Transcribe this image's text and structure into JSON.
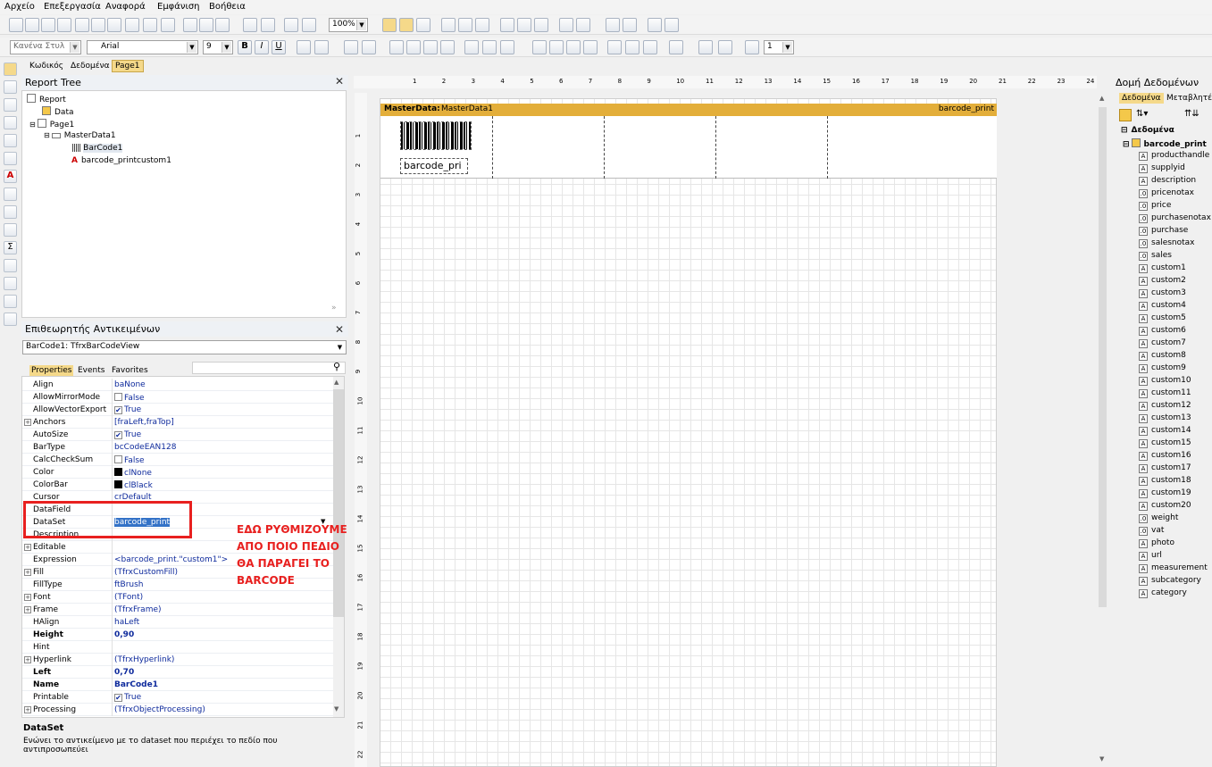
{
  "menu": [
    "Αρχείο",
    "Επεξεργασία",
    "Αναφορά",
    "Εμφάνιση",
    "Βοήθεια"
  ],
  "toolbar": {
    "zoom": "100%"
  },
  "format_toolbar": {
    "style": "Κανένα Στυλ",
    "font": "Arial",
    "size": "9",
    "bold": "B",
    "italic": "I",
    "underline": "U",
    "frame_width": "1"
  },
  "tabs": [
    "Κωδικός",
    "Δεδομένα",
    "Page1"
  ],
  "report_tree": {
    "title": "Report Tree",
    "nodes": [
      "Report",
      "Data",
      "Page1",
      "MasterData1",
      "BarCode1",
      "barcode_printcustom1"
    ]
  },
  "inspector": {
    "title": "Επιθεωρητής Αντικειμένων",
    "object": "BarCode1: TfrxBarCodeView",
    "tabs": [
      "Properties",
      "Events",
      "Favorites"
    ],
    "rows": [
      {
        "name": "Align",
        "value": "baNone"
      },
      {
        "name": "AllowMirrorMode",
        "value": "False"
      },
      {
        "name": "AllowVectorExport",
        "value": "True"
      },
      {
        "name": "Anchors",
        "value": "[fraLeft,fraTop]"
      },
      {
        "name": "AutoSize",
        "value": "True"
      },
      {
        "name": "BarType",
        "value": "bcCodeEAN128"
      },
      {
        "name": "CalcCheckSum",
        "value": "False"
      },
      {
        "name": "Color",
        "value": "clNone"
      },
      {
        "name": "ColorBar",
        "value": "clBlack"
      },
      {
        "name": "Cursor",
        "value": "crDefault"
      },
      {
        "name": "DataField",
        "value": ""
      },
      {
        "name": "DataSet",
        "value": "barcode_print"
      },
      {
        "name": "Description",
        "value": ""
      },
      {
        "name": "Editable",
        "value": ""
      },
      {
        "name": "Expression",
        "value": "<barcode_print.\"custom1\">"
      },
      {
        "name": "Fill",
        "value": "(TfrxCustomFill)"
      },
      {
        "name": "FillType",
        "value": "ftBrush"
      },
      {
        "name": "Font",
        "value": "(TFont)"
      },
      {
        "name": "Frame",
        "value": "(TfrxFrame)"
      },
      {
        "name": "HAlign",
        "value": "haLeft"
      },
      {
        "name": "Height",
        "value": "0,90"
      },
      {
        "name": "Hint",
        "value": ""
      },
      {
        "name": "Hyperlink",
        "value": "(TfrxHyperlink)"
      },
      {
        "name": "Left",
        "value": "0,70"
      },
      {
        "name": "Name",
        "value": "BarCode1"
      },
      {
        "name": "Printable",
        "value": "True"
      },
      {
        "name": "Processing",
        "value": "(TfrxObjectProcessing)"
      }
    ],
    "help_title": "DataSet",
    "help_text": "Ενώνει το αντικείμενο με το dataset που περιέχει το πεδίο που αντιπροσωπεύει"
  },
  "annotation": [
    "ΕΔΩ ΡΥΘΜΙΖΟΥΜΕ",
    "ΑΠΟ ΠΟΙΟ ΠΕΔΙΟ",
    "ΘΑ ΠΑΡΑΓΕΙ ΤΟ",
    "BARCODE"
  ],
  "designer": {
    "band_title_bold": "MasterData:",
    "band_title": "MasterData1",
    "band_dataset": "barcode_print",
    "barcode_text": "barcode_pri",
    "ruler_top": [
      "1",
      "2",
      "3",
      "4",
      "5",
      "6",
      "7",
      "8",
      "9",
      "10",
      "11",
      "12",
      "13",
      "14",
      "15",
      "16",
      "17",
      "18",
      "19",
      "20",
      "21",
      "22",
      "23",
      "24"
    ],
    "ruler_left": [
      "1",
      "2",
      "3",
      "4",
      "5",
      "6",
      "7",
      "8",
      "9",
      "10",
      "11",
      "12",
      "13",
      "14",
      "15",
      "16",
      "17",
      "18",
      "19",
      "20",
      "21",
      "22"
    ]
  },
  "data_tree": {
    "title": "Δομή Δεδομένων",
    "tabs": [
      "Δεδομένα",
      "Μεταβλητές"
    ],
    "root": "Δεδομένα",
    "dataset": "barcode_print",
    "fields": [
      {
        "name": "producthandle",
        "type": "A"
      },
      {
        "name": "supplyid",
        "type": "A"
      },
      {
        "name": "description",
        "type": "A"
      },
      {
        "name": "pricenotax",
        "type": ".0"
      },
      {
        "name": "price",
        "type": ".0"
      },
      {
        "name": "purchasenotax",
        "type": ".0"
      },
      {
        "name": "purchase",
        "type": ".0"
      },
      {
        "name": "salesnotax",
        "type": ".0"
      },
      {
        "name": "sales",
        "type": ".0"
      },
      {
        "name": "custom1",
        "type": "A"
      },
      {
        "name": "custom2",
        "type": "A"
      },
      {
        "name": "custom3",
        "type": "A"
      },
      {
        "name": "custom4",
        "type": "A"
      },
      {
        "name": "custom5",
        "type": "A"
      },
      {
        "name": "custom6",
        "type": "A"
      },
      {
        "name": "custom7",
        "type": "A"
      },
      {
        "name": "custom8",
        "type": "A"
      },
      {
        "name": "custom9",
        "type": "A"
      },
      {
        "name": "custom10",
        "type": "A"
      },
      {
        "name": "custom11",
        "type": "A"
      },
      {
        "name": "custom12",
        "type": "A"
      },
      {
        "name": "custom13",
        "type": "A"
      },
      {
        "name": "custom14",
        "type": "A"
      },
      {
        "name": "custom15",
        "type": "A"
      },
      {
        "name": "custom16",
        "type": "A"
      },
      {
        "name": "custom17",
        "type": "A"
      },
      {
        "name": "custom18",
        "type": "A"
      },
      {
        "name": "custom19",
        "type": "A"
      },
      {
        "name": "custom20",
        "type": "A"
      },
      {
        "name": "weight",
        "type": ".0"
      },
      {
        "name": "vat",
        "type": ".0"
      },
      {
        "name": "photo",
        "type": "A"
      },
      {
        "name": "url",
        "type": "A"
      },
      {
        "name": "measurement",
        "type": "A"
      },
      {
        "name": "subcategory",
        "type": "A"
      },
      {
        "name": "category",
        "type": "A"
      }
    ]
  }
}
